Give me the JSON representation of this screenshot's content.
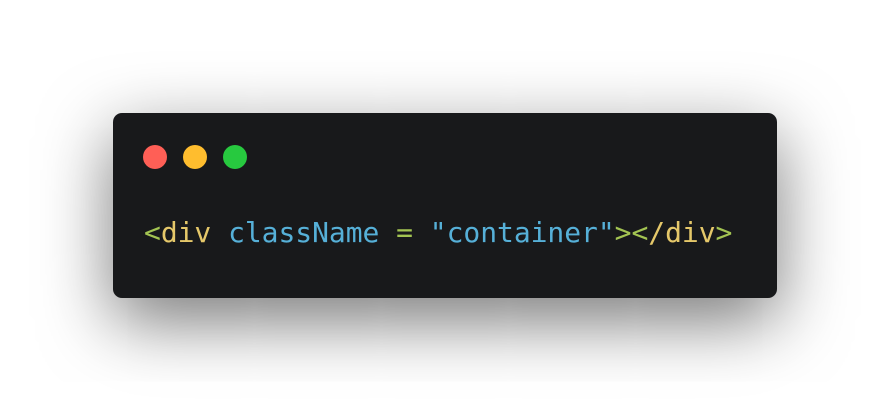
{
  "window": {
    "controls": [
      {
        "name": "close",
        "color": "#ff5f56"
      },
      {
        "name": "minimize",
        "color": "#ffbd2e"
      },
      {
        "name": "maximize",
        "color": "#27c93f"
      }
    ]
  },
  "code": {
    "tokens": [
      "<",
      "div",
      " ",
      "className",
      " ",
      "=",
      " ",
      "\"container\"",
      "><",
      "/div",
      ">"
    ],
    "colors": {
      "punct": "#a3c452",
      "tag": "#e5c86a",
      "attr": "#56b0d8",
      "string": "#56b0d8"
    }
  }
}
